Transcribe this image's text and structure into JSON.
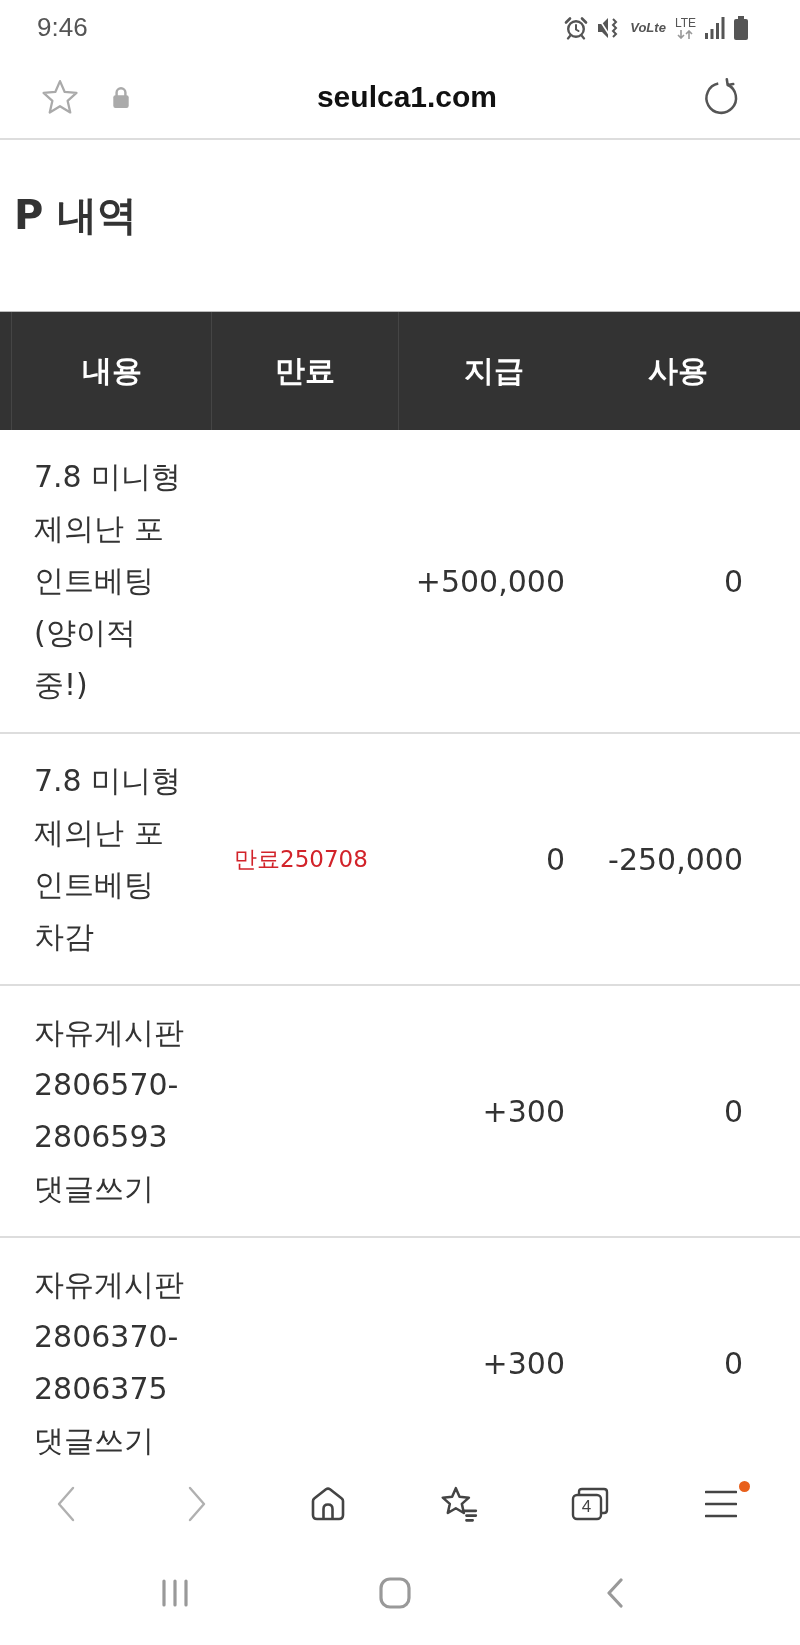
{
  "status_bar": {
    "time": "9:46",
    "indicators": [
      {
        "kind": "volte",
        "label": "VoLte"
      },
      {
        "kind": "lte",
        "label": "LTE"
      }
    ]
  },
  "address_bar": {
    "url": "seulca1.com",
    "secure": true,
    "bookmarked": false
  },
  "page": {
    "title": "P 내역"
  },
  "table": {
    "columns": [
      "내용",
      "만료",
      "지급",
      "사용"
    ],
    "rows": [
      {
        "content": "7.8 미니형 제의난 포인트베팅(양이적중!)",
        "granted": "+500,000",
        "used": "0"
      },
      {
        "content": "7.8 미니형 제의난 포인트베팅 차감",
        "expiry": "만료250708",
        "granted": "0",
        "used": "-250,000"
      },
      {
        "content": "자유게시판 2806570-2806593 댓글쓰기",
        "granted": "+300",
        "used": "0"
      },
      {
        "content": "자유게시판 2806370-2806375 댓글쓰기",
        "granted": "+300",
        "used": "0"
      }
    ]
  },
  "toolbar": [
    {
      "kind": "back",
      "disabled": true,
      "notification": false
    },
    {
      "kind": "forward",
      "disabled": true,
      "notification": false
    },
    {
      "kind": "home",
      "disabled": false,
      "notification": false
    },
    {
      "kind": "bookmarks",
      "disabled": false,
      "notification": false
    },
    {
      "kind": "tabs",
      "count": "4",
      "disabled": false,
      "notification": false
    },
    {
      "kind": "menu",
      "disabled": false,
      "notification": true
    }
  ]
}
